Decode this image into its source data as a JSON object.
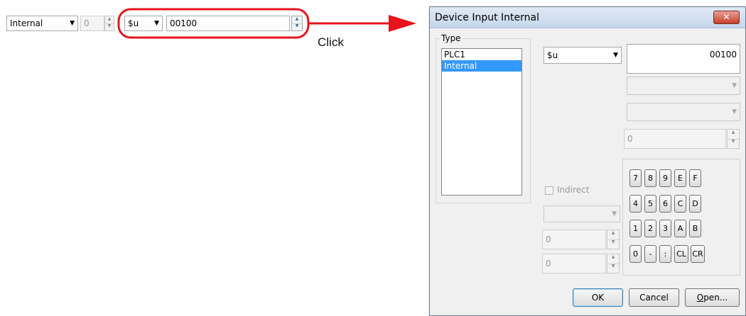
{
  "toolbar": {
    "type_value": "Internal",
    "number_value": "0",
    "address_prefix": "$u",
    "address_value": "00100"
  },
  "annotation": {
    "click_label": "Click",
    "highlight_color": "#e8141b"
  },
  "dialog": {
    "title": "Device Input  Internal",
    "type_group_label": "Type",
    "type_items": [
      "PLC1",
      "Internal"
    ],
    "selected_type": "Internal",
    "device_select": "$u",
    "address_value": "00100",
    "number_field": "0",
    "indirect_label": "Indirect",
    "indirect_field_1": "0",
    "indirect_field_2": "0",
    "keypad": [
      [
        "7",
        "8",
        "9",
        "E",
        "F"
      ],
      [
        "4",
        "5",
        "6",
        "C",
        "D"
      ],
      [
        "1",
        "2",
        "3",
        "A",
        "B"
      ],
      [
        "0",
        "-",
        ":",
        "CL",
        "CR"
      ]
    ],
    "ok_label": "OK",
    "cancel_label": "Cancel",
    "open_label": "Open...",
    "open_mnemonic": "O"
  }
}
